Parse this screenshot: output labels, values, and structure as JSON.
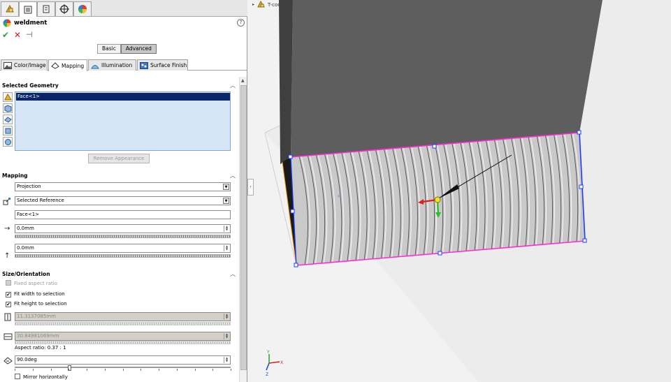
{
  "feature": {
    "name": "weldment",
    "help_symbol": "?"
  },
  "actions": {
    "ok": "✔",
    "cancel": "✕",
    "pin": "⊣"
  },
  "mode": {
    "basic": "Basic",
    "advanced": "Advanced",
    "selected": "Advanced"
  },
  "top_tabs": [
    "feature-manager-icon",
    "property-manager-icon",
    "configuration-manager-icon",
    "dimxpert-icon",
    "display-manager-icon"
  ],
  "sub_tabs": [
    {
      "label": "Color/Image",
      "icon": "image-icon"
    },
    {
      "label": "Mapping",
      "icon": "mapping-icon"
    },
    {
      "label": "Illumination",
      "icon": "illumination-icon"
    },
    {
      "label": "Surface Finish",
      "icon": "surface-finish-icon"
    }
  ],
  "selected_geometry": {
    "title": "Selected Geometry",
    "items": [
      "Face<1>"
    ],
    "remove_label": "Remove Appearance"
  },
  "mapping": {
    "title": "Mapping",
    "style": "Projection",
    "reference_type": "Selected Reference",
    "reference": "Face<1>",
    "horizontal": "0.0mm",
    "vertical": "0.0mm"
  },
  "size_orientation": {
    "title": "Size/Orientation",
    "fixed_aspect_label": "Fixed aspect ratio",
    "fixed_aspect_checked": false,
    "fit_width_label": "Fit width to selection",
    "fit_width_checked": true,
    "fit_height_label": "Fit height to selection",
    "fit_height_checked": true,
    "width": "11.3137085mm",
    "height": "30.84981069mm",
    "aspect_ratio": "Aspect ratio: 0.37 : 1",
    "rotation": "90.0deg",
    "rotation_fraction": 0.25,
    "mirror_horizontal_label": "Mirror horizontally",
    "mirror_horizontal_checked": false
  },
  "graphics": {
    "tree_item": "T-connection with caterpilla...",
    "colors": {
      "selection_edge": "#ff2bd6",
      "edge_blue": "#1a3cff",
      "top_face": "#5e5e5e",
      "side_face": "#c9c9c9",
      "floor": "#ececec"
    }
  }
}
